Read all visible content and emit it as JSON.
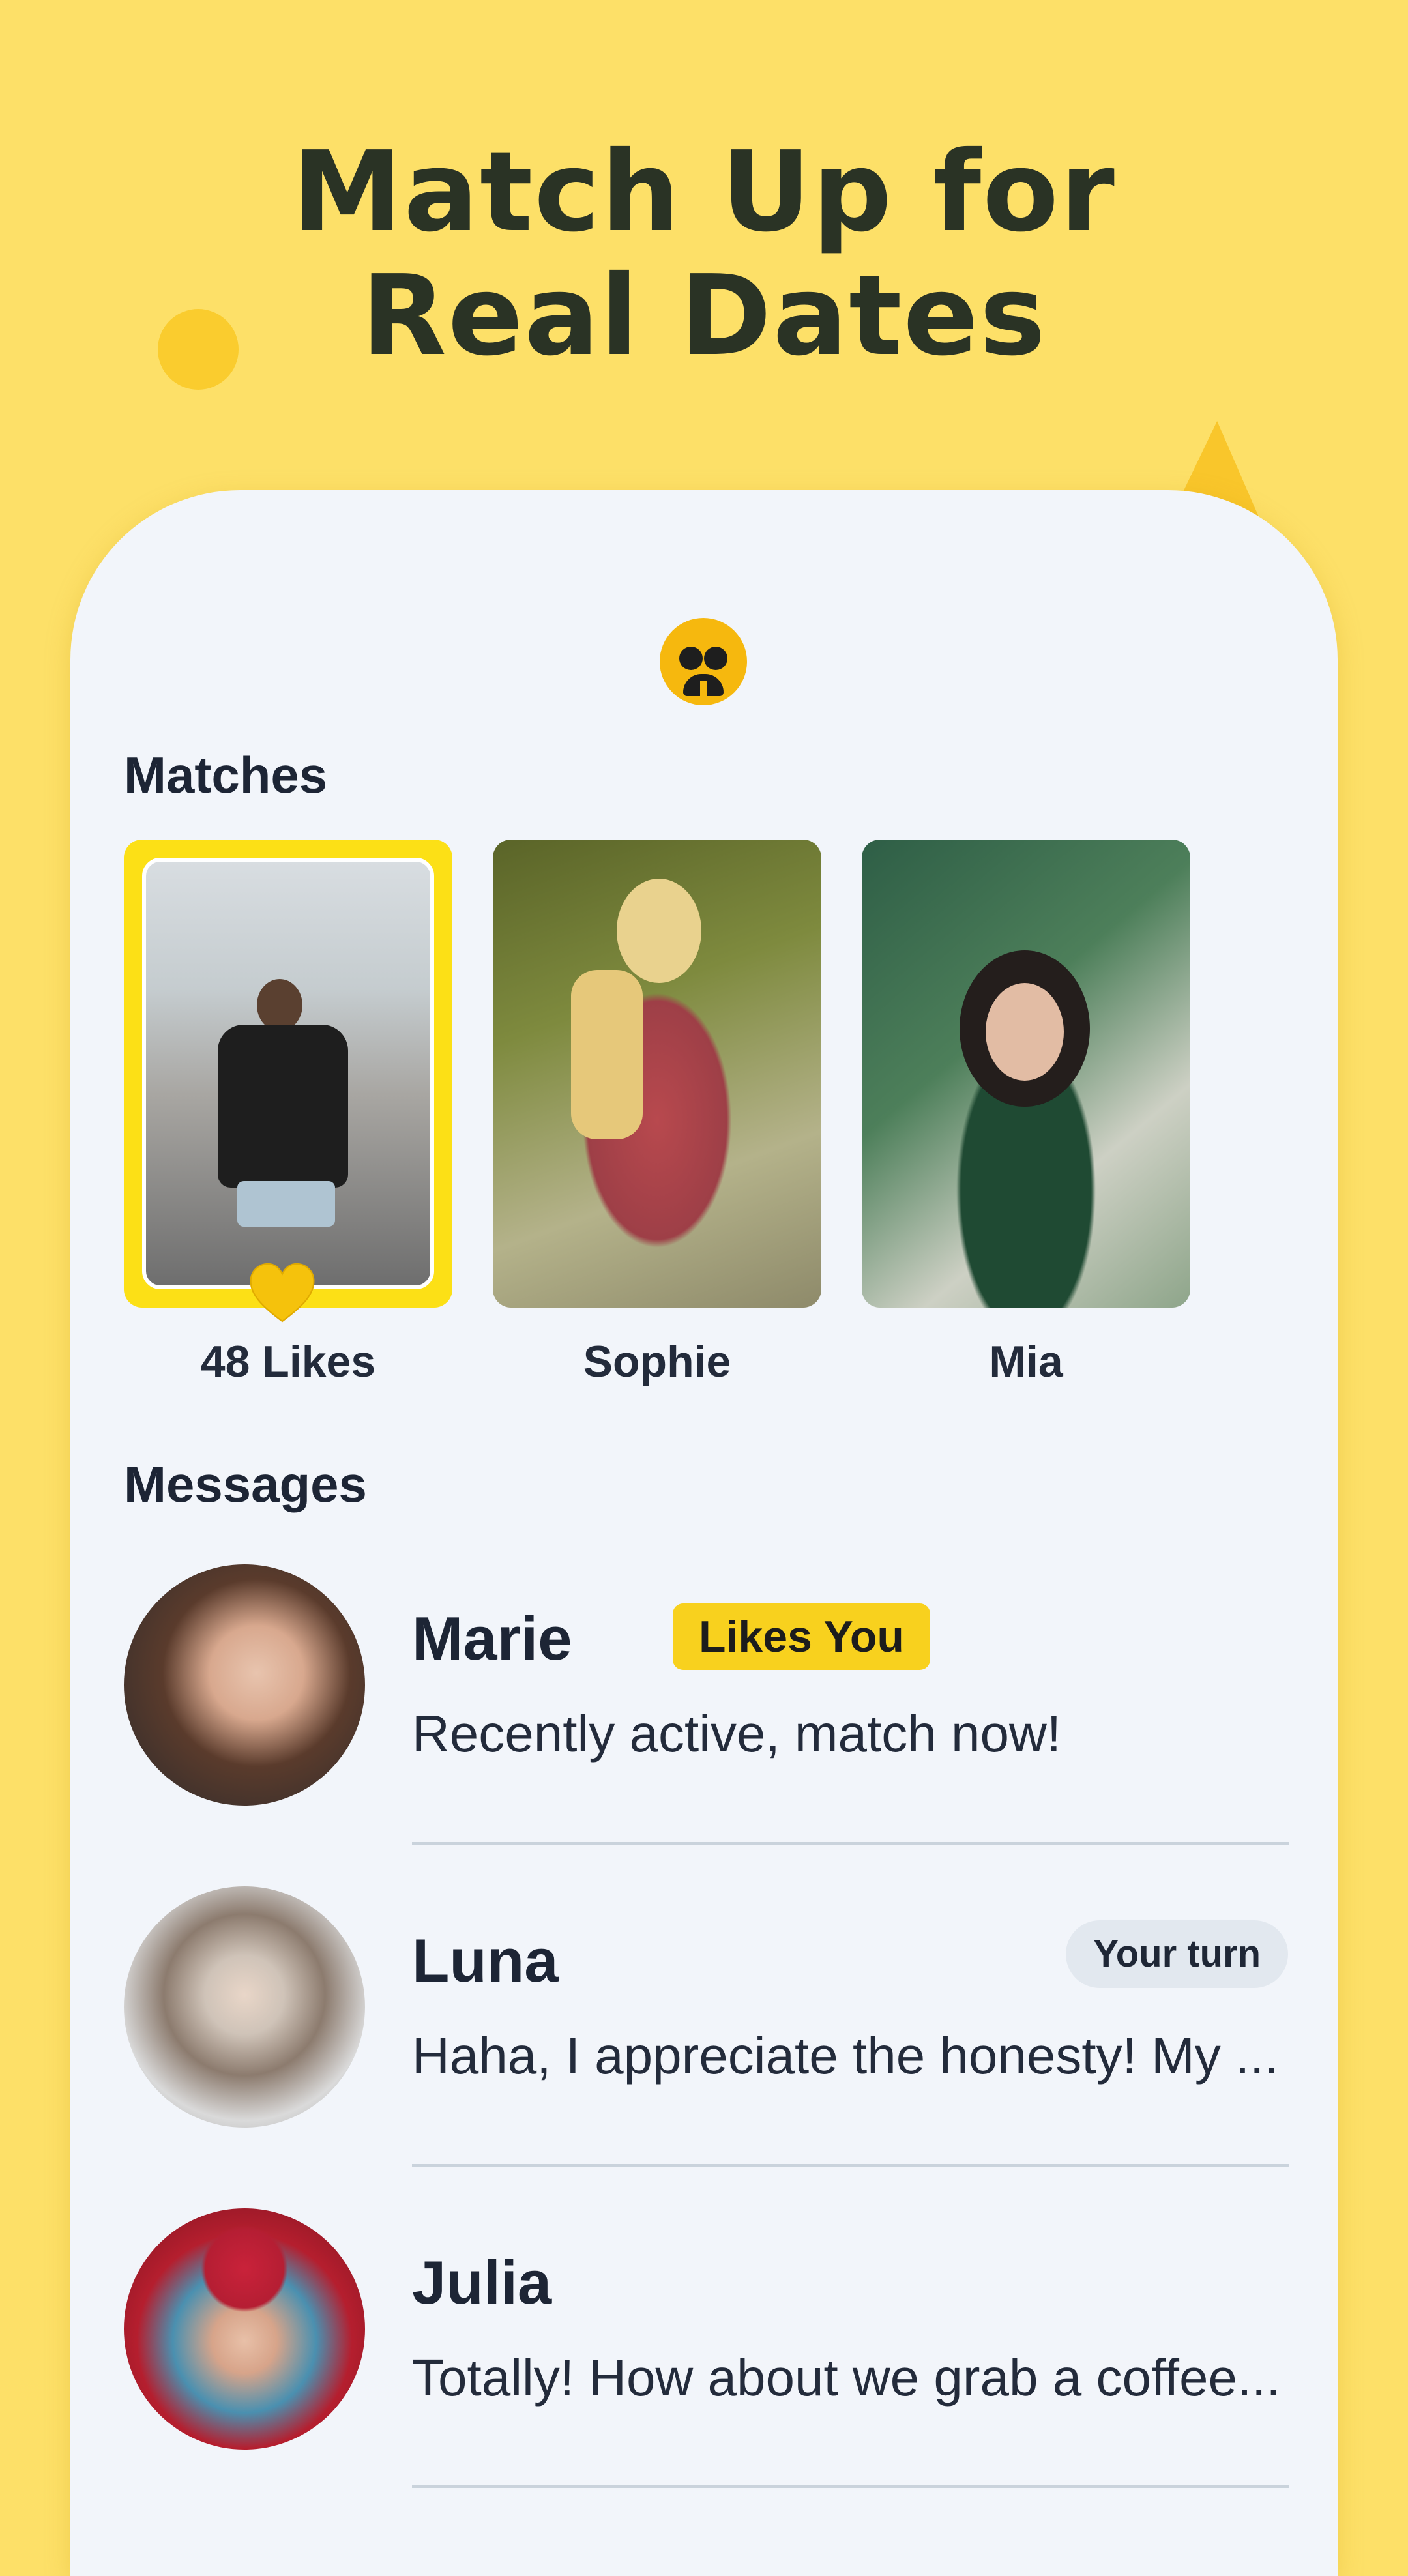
{
  "headline": {
    "line1": "Match Up for",
    "line2": "Real Dates"
  },
  "sections": {
    "matches": "Matches",
    "messages": "Messages"
  },
  "matches": [
    {
      "label": "48 Likes",
      "highlighted": true
    },
    {
      "label": "Sophie"
    },
    {
      "label": "Mia"
    }
  ],
  "messages": [
    {
      "name": "Marie",
      "badge": "Likes You",
      "preview": "Recently active, match now!"
    },
    {
      "name": "Luna",
      "badge": "Your turn",
      "preview": "Haha, I appreciate the honesty! My ..."
    },
    {
      "name": "Julia",
      "preview": "Totally! How about we grab a coffee..."
    }
  ],
  "colors": {
    "background": "#FDE068",
    "accent": "#F8D11E",
    "heart": "#F5C20C"
  }
}
